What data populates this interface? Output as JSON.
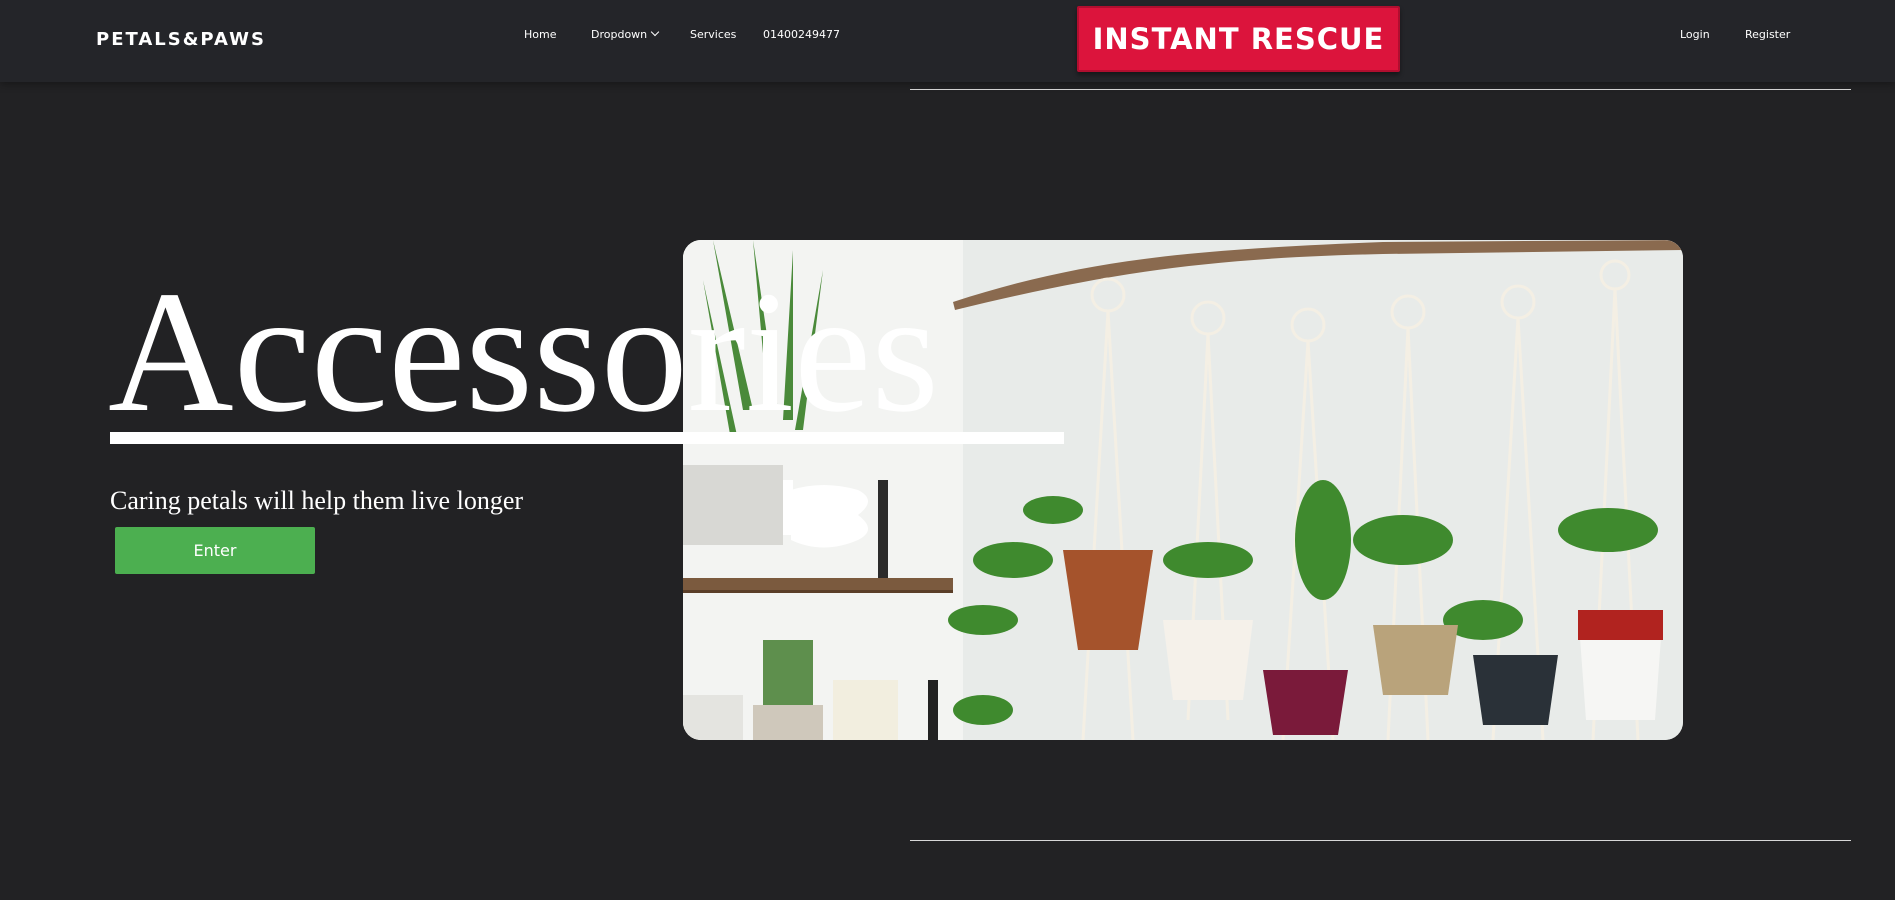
{
  "nav": {
    "brand": "PETALS&PAWS",
    "home": "Home",
    "dropdown": "Dropdown",
    "services": "Services",
    "phone": "01400249477",
    "rescue": "INSTANT RESCUE",
    "login": "Login",
    "register": "Register"
  },
  "hero": {
    "title": "Accessories",
    "subtitle": "Caring petals will help them live longer",
    "enter": "Enter"
  },
  "colors": {
    "background": "#222224",
    "navbar": "#242529",
    "rescue": "#dc143c",
    "enter": "#4caf50"
  },
  "icons": {
    "dropdown_caret": "chevron-down-icon"
  }
}
